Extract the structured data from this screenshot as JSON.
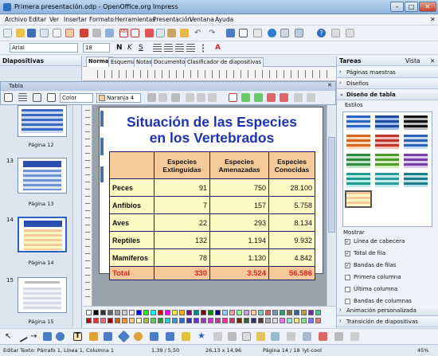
{
  "window": {
    "title": "Primera presentación.odp - OpenOffice.org Impress"
  },
  "menu": [
    "Archivo",
    "Editar",
    "Ver",
    "Insertar",
    "Formato",
    "Herramientas",
    "Presentación",
    "Ventana",
    "Ayuda"
  ],
  "format_bar": {
    "font_name": "Arial",
    "font_size": "18"
  },
  "slides_pane": {
    "title": "Diapositivas",
    "thumbs": [
      {
        "number": "",
        "label": "Página 12"
      },
      {
        "number": "13",
        "label": "Página 13"
      },
      {
        "number": "14",
        "label": "Página 14"
      },
      {
        "number": "15",
        "label": "Página 15"
      }
    ]
  },
  "view_tabs": [
    "Normal",
    "Esquema",
    "Notas",
    "Documento",
    "Clasificador de diapositivas"
  ],
  "table_toolbar": {
    "title": "Tabla",
    "color_mode": "Color",
    "fill": "Naranja 4"
  },
  "slide": {
    "title_line1": "Situación de las Especies",
    "title_line2": "en los Vertebrados",
    "table": {
      "headers": [
        "Especies Extinguidas",
        "Especies Amenazadas",
        "Especies Conocidas"
      ],
      "rows": [
        {
          "name": "Peces",
          "values": [
            "91",
            "750",
            "28.100"
          ]
        },
        {
          "name": "Anfibios",
          "values": [
            "7",
            "157",
            "5.758"
          ]
        },
        {
          "name": "Aves",
          "values": [
            "22",
            "293",
            "8.134"
          ]
        },
        {
          "name": "Reptiles",
          "values": [
            "132",
            "1.194",
            "9.932"
          ]
        },
        {
          "name": "Mamíferos",
          "values": [
            "78",
            "1.130",
            "4.842"
          ]
        }
      ],
      "total": {
        "name": "Total",
        "values": [
          "330",
          "3.524",
          "56.586"
        ]
      }
    }
  },
  "tasks_pane": {
    "title": "Tareas",
    "view_label": "Vista",
    "sections_top": [
      "Páginas maestras",
      "Diseños",
      "Diseño de tabla"
    ],
    "styles_label": "Estilos",
    "show_label": "Mostrar",
    "options": [
      {
        "label": "Línea de cabecera",
        "checked": true
      },
      {
        "label": "Total de fila",
        "checked": true
      },
      {
        "label": "Bandas de filas",
        "checked": true
      },
      {
        "label": "Primera columna",
        "checked": false
      },
      {
        "label": "Última columna",
        "checked": false
      },
      {
        "label": "Bandas de columnas",
        "checked": false
      }
    ],
    "sections_bottom": [
      "Animación personalizada",
      "Transición de diapositivas"
    ]
  },
  "status": {
    "edit_text": "Editar Texto: Párrafo 1, Línea 1, Columna 1",
    "position": "1,39 / 5,50",
    "size": "26,13 x 14,96",
    "page": "Página 14 / 18",
    "layout": "lyt-cool",
    "zoom": "45%"
  },
  "colors": {
    "title": "#1e32b4",
    "header_fill": "#f6c99a",
    "row_fill": "#fdf9c2",
    "total_text": "#e81e1e",
    "accent": "#2a63c4"
  }
}
